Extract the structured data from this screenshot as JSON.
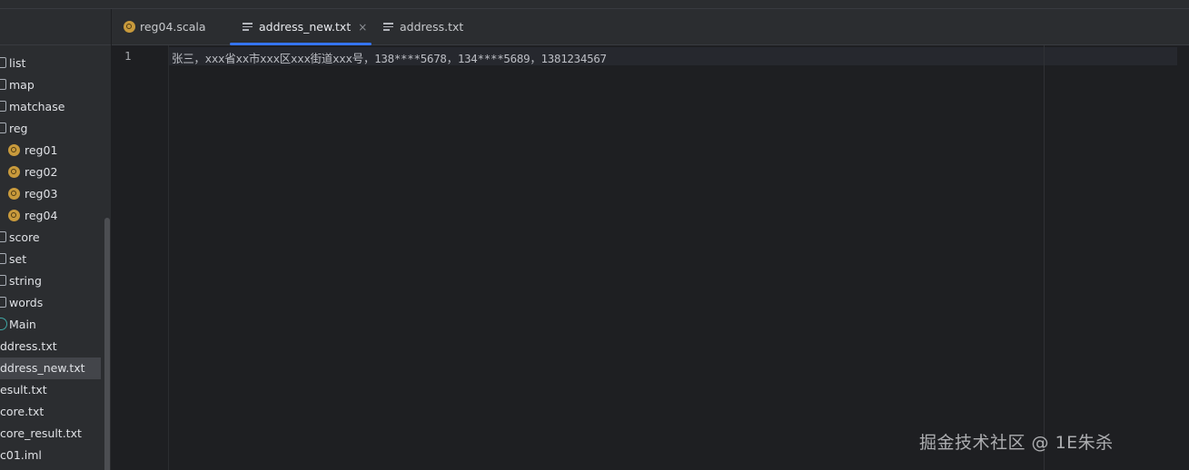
{
  "sidebar": {
    "items": [
      {
        "label": "list",
        "icon": "folder-icon"
      },
      {
        "label": "map",
        "icon": "folder-icon"
      },
      {
        "label": "matchase",
        "icon": "folder-icon"
      },
      {
        "label": "reg",
        "icon": "folder-icon"
      },
      {
        "label": "reg01",
        "icon": "scala-object-icon"
      },
      {
        "label": "reg02",
        "icon": "scala-object-icon"
      },
      {
        "label": "reg03",
        "icon": "scala-object-icon"
      },
      {
        "label": "reg04",
        "icon": "scala-object-icon"
      },
      {
        "label": "score",
        "icon": "folder-icon"
      },
      {
        "label": "set",
        "icon": "folder-icon"
      },
      {
        "label": "string",
        "icon": "folder-icon"
      },
      {
        "label": "words",
        "icon": "folder-icon"
      },
      {
        "label": "Main",
        "icon": "scala-main-icon"
      },
      {
        "label": "ddress.txt",
        "icon": ""
      },
      {
        "label": "ddress_new.txt",
        "icon": ""
      },
      {
        "label": "esult.txt",
        "icon": ""
      },
      {
        "label": "core.txt",
        "icon": ""
      },
      {
        "label": "core_result.txt",
        "icon": ""
      },
      {
        "label": "c01.iml",
        "icon": ""
      }
    ],
    "selected": "ddress_new.txt"
  },
  "tabs": [
    {
      "label": "reg04.scala",
      "icon": "scala-file-icon",
      "active": false
    },
    {
      "label": "address_new.txt",
      "icon": "text-file-icon",
      "active": true,
      "close": "×"
    },
    {
      "label": "address.txt",
      "icon": "text-file-icon",
      "active": false
    }
  ],
  "editor": {
    "lines": [
      {
        "number": "1",
        "text": "张三，xxx省xx市xxx区xxx街道xxx号，138****5678，134****5689，1381234567"
      }
    ]
  },
  "watermark": "掘金技术社区 @ 1E朱杀",
  "colors": {
    "accent": "#3574f0",
    "background": "#1e1f22",
    "panel": "#2b2d30",
    "scala_icon": "#c89a3c"
  }
}
